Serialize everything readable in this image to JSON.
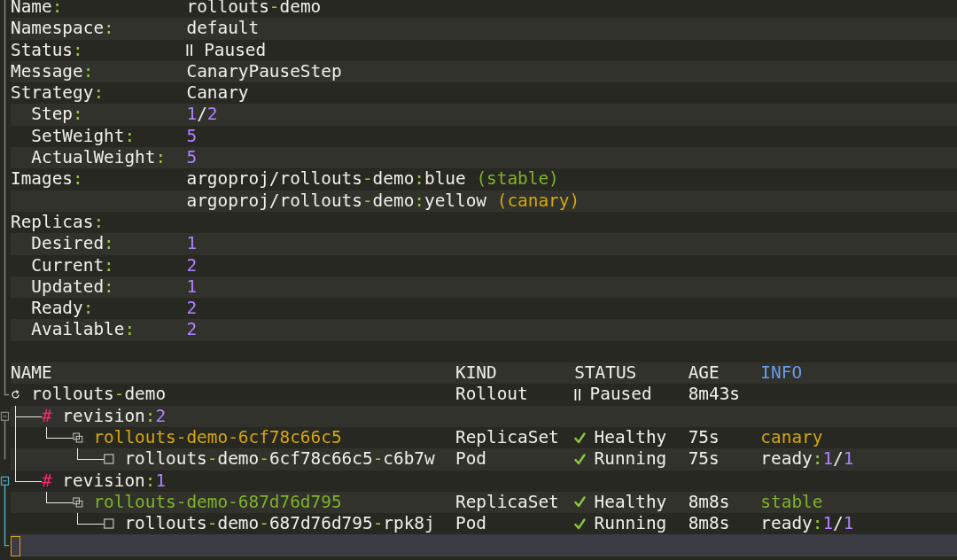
{
  "details": [
    {
      "kind": "text",
      "label": "Name:",
      "value": "rollouts-demo"
    },
    {
      "kind": "text",
      "label": "Namespace:",
      "value": "default"
    },
    {
      "kind": "status",
      "label": "Status:",
      "value": "Paused"
    },
    {
      "kind": "text",
      "label": "Message:",
      "value": "CanaryPauseStep"
    },
    {
      "kind": "text",
      "label": "Strategy:",
      "value": "Canary",
      "children": [
        {
          "kind": "text",
          "label": "Step:",
          "value": "1/2"
        },
        {
          "kind": "text",
          "label": "SetWeight:",
          "value": "5"
        },
        {
          "kind": "text",
          "label": "ActualWeight:",
          "value": "5"
        }
      ]
    },
    {
      "kind": "images",
      "label": "Images:",
      "values": [
        {
          "image": "argoproj/rollouts-demo:blue",
          "tag": "(stable)",
          "color": "#7fb32a"
        },
        {
          "image": "argoproj/rollouts-demo:yellow",
          "tag": "(canary)",
          "color": "#d6a70c"
        }
      ]
    },
    {
      "kind": "text",
      "label": "Replicas:",
      "children": [
        {
          "kind": "text",
          "label": "Desired:",
          "value": "1"
        },
        {
          "kind": "text",
          "label": "Current:",
          "value": "2"
        },
        {
          "kind": "text",
          "label": "Updated:",
          "value": "1"
        },
        {
          "kind": "text",
          "label": "Ready:",
          "value": "2"
        },
        {
          "kind": "text",
          "label": "Available:",
          "value": "2"
        }
      ]
    }
  ],
  "tree": {
    "columns": [
      {
        "label": "NAME",
        "color": "#f0f0ea"
      },
      {
        "label": "KIND",
        "color": "#f0f0ea"
      },
      {
        "label": "STATUS",
        "color": "#f0f0ea"
      },
      {
        "label": "AGE",
        "color": "#f0f0ea"
      },
      {
        "label": "INFO",
        "color": "#6b9bea"
      }
    ],
    "root": {
      "kind": "rollout",
      "name": "rollouts-demo",
      "resource": "Rollout",
      "status": {
        "kind": "paused",
        "text": "Paused"
      },
      "age": "8m43s",
      "children": [
        {
          "kind": "revision",
          "marker": "#",
          "name": "revision:2",
          "children": [
            {
              "kind": "replicaset",
              "name": "rollouts-demo-6cf78c66c5",
              "color": "#d6a70c",
              "resource": "ReplicaSet",
              "status": {
                "kind": "ok",
                "text": "Healthy"
              },
              "age": "75s",
              "info": {
                "text": "canary",
                "color": "#d6a70c"
              },
              "children": [
                {
                  "kind": "pod",
                  "name": "rollouts-demo-6cf78c66c5-c6b7w",
                  "resource": "Pod",
                  "status": {
                    "kind": "ok",
                    "text": "Running"
                  },
                  "age": "75s",
                  "info": {
                    "text": "ready:1/1"
                  }
                }
              ]
            }
          ]
        },
        {
          "kind": "revision",
          "marker": "#",
          "name": "revision:1",
          "children": [
            {
              "kind": "replicaset",
              "name": "rollouts-demo-687d76d795",
              "color": "#7fb32a",
              "resource": "ReplicaSet",
              "status": {
                "kind": "ok",
                "text": "Healthy"
              },
              "age": "8m8s",
              "info": {
                "text": "stable",
                "color": "#7fb32a"
              },
              "children": [
                {
                  "kind": "pod",
                  "name": "rollouts-demo-687d76d795-rpk8j",
                  "resource": "Pod",
                  "status": {
                    "kind": "ok",
                    "text": "Running"
                  },
                  "age": "8m8s",
                  "info": {
                    "text": "ready:1/1"
                  }
                }
              ]
            }
          ]
        }
      ]
    }
  }
}
